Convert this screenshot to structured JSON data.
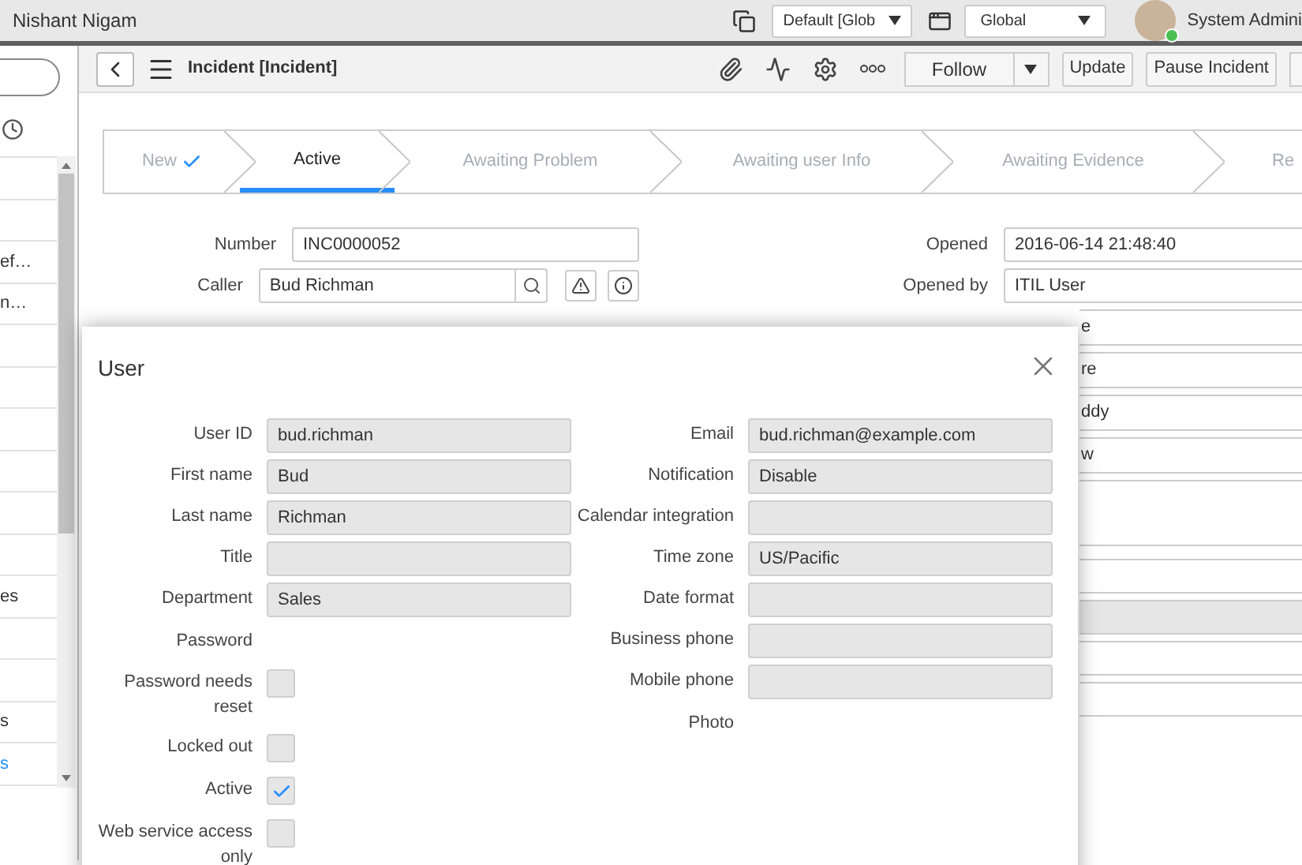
{
  "header": {
    "user_name": "Nishant Nigam",
    "update_set": "Default [Glob",
    "scope": "Global",
    "account": "System Admini"
  },
  "sidebar": {
    "items": [
      {
        "label": "ef…",
        "kind": "text"
      },
      {
        "label": "n…",
        "kind": "text"
      },
      {
        "label": "es",
        "kind": "text"
      },
      {
        "label": "s",
        "kind": "text"
      },
      {
        "label": "s",
        "kind": "link"
      }
    ]
  },
  "toolbar": {
    "title": "Incident [Incident]",
    "buttons": [
      "Update",
      "Pause Incident"
    ],
    "follow": "Follow"
  },
  "process": {
    "steps": [
      {
        "label": "New",
        "done": true,
        "selected": false
      },
      {
        "label": "Active",
        "done": false,
        "selected": true
      },
      {
        "label": "Awaiting Problem",
        "done": false,
        "selected": false
      },
      {
        "label": "Awaiting user Info",
        "done": false,
        "selected": false
      },
      {
        "label": "Awaiting Evidence",
        "done": false,
        "selected": false
      },
      {
        "label": "Re",
        "done": false,
        "selected": false
      }
    ]
  },
  "form": {
    "left": [
      {
        "label": "Number",
        "value": "INC0000052"
      },
      {
        "label": "Caller",
        "value": "Bud Richman"
      }
    ],
    "right": [
      {
        "label": "Opened",
        "value": "2016-06-14 21:48:40"
      },
      {
        "label": "Opened by",
        "value": "ITIL User"
      }
    ],
    "behind": [
      "e",
      "re",
      "ddy",
      "w"
    ]
  },
  "dialog": {
    "title": "User",
    "left": [
      {
        "kind": "field",
        "label": "User ID",
        "value": "bud.richman"
      },
      {
        "kind": "field",
        "label": "First name",
        "value": "Bud"
      },
      {
        "kind": "field",
        "label": "Last name",
        "value": "Richman"
      },
      {
        "kind": "field",
        "label": "Title"
      },
      {
        "kind": "field",
        "label": "Department",
        "value": "Sales"
      },
      {
        "kind": "label",
        "label": "Password"
      },
      {
        "kind": "checkbox",
        "label": "Password needs reset",
        "checked": false
      },
      {
        "kind": "checkbox",
        "label": "Locked out",
        "checked": false
      },
      {
        "kind": "checkbox",
        "label": "Active",
        "checked": true
      },
      {
        "kind": "checkbox",
        "label": "Web service access only",
        "checked": false
      }
    ],
    "right": [
      {
        "kind": "field",
        "label": "Email",
        "value": "bud.richman@example.com"
      },
      {
        "kind": "field",
        "label": "Notification",
        "value": "Disable"
      },
      {
        "kind": "field",
        "label": "Calendar integration"
      },
      {
        "kind": "field",
        "label": "Time zone",
        "value": "US/Pacific"
      },
      {
        "kind": "field",
        "label": "Date format"
      },
      {
        "kind": "field",
        "label": "Business phone"
      },
      {
        "kind": "field",
        "label": "Mobile phone"
      },
      {
        "kind": "label",
        "label": "Photo"
      }
    ]
  }
}
